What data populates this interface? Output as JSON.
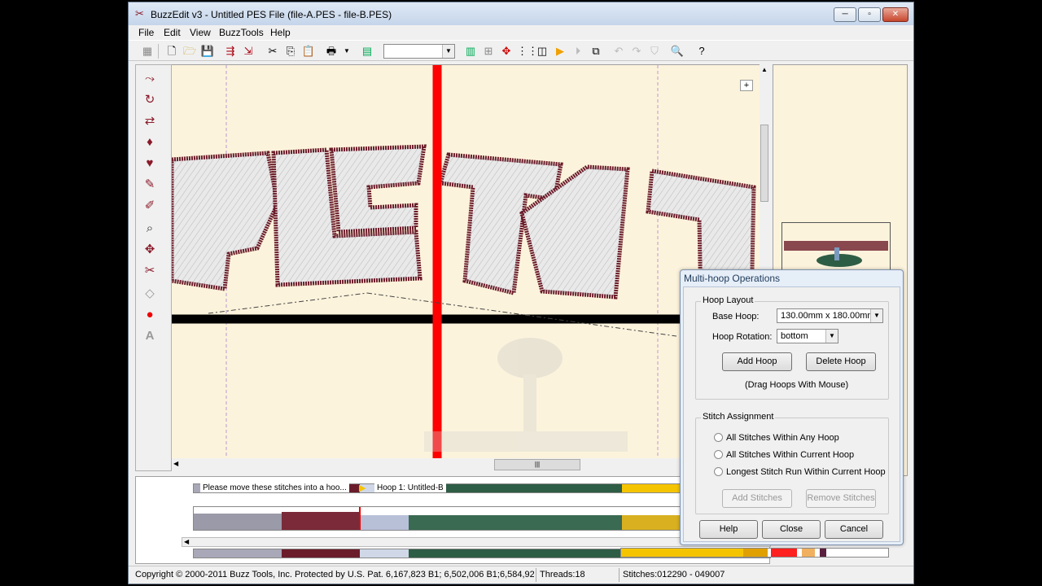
{
  "window": {
    "title": "BuzzEdit v3 - Untitled PES File (file-A.PES - file-B.PES)"
  },
  "menu": [
    "File",
    "Edit",
    "View",
    "BuzzTools",
    "Help"
  ],
  "canvas": {
    "embroidery_text": "PLETAT"
  },
  "timeline": {
    "note_label": "Please move these stitches into a hoo...",
    "hoop_label": "Hoop 1: Untitled-B"
  },
  "status": {
    "copyright": "Copyright © 2000-2011 Buzz Tools, Inc. Protected by U.S. Pat. 6,167,823 B1; 6,502,006 B1;6,584,921 B",
    "threads": "Threads:18",
    "stitches": "Stitches:012290 - 049007"
  },
  "dialog": {
    "title": "Multi-hoop Operations",
    "hoop_layout": {
      "group_label": "Hoop Layout",
      "base_hoop_label": "Base Hoop:",
      "base_hoop_value": "130.00mm x 180.00mm",
      "rotation_label": "Hoop Rotation:",
      "rotation_value": "bottom",
      "add_hoop": "Add Hoop",
      "delete_hoop": "Delete Hoop",
      "drag_hint": "(Drag Hoops With Mouse)"
    },
    "stitch_assignment": {
      "group_label": "Stitch Assignment",
      "options": [
        "All Stitches Within Any Hoop",
        "All Stitches Within Current Hoop",
        "Longest Stitch Run Within Current Hoop"
      ],
      "add_stitches": "Add Stitches",
      "remove_stitches": "Remove Stitches"
    },
    "buttons": {
      "help": "Help",
      "close": "Close",
      "cancel": "Cancel"
    }
  },
  "colors": {
    "thread_maroon": "#6b1c2a",
    "hoop_red": "#ff0000",
    "canvas_bg": "#fcf3dc",
    "green": "#2e5d45",
    "yellow": "#f5c400"
  }
}
